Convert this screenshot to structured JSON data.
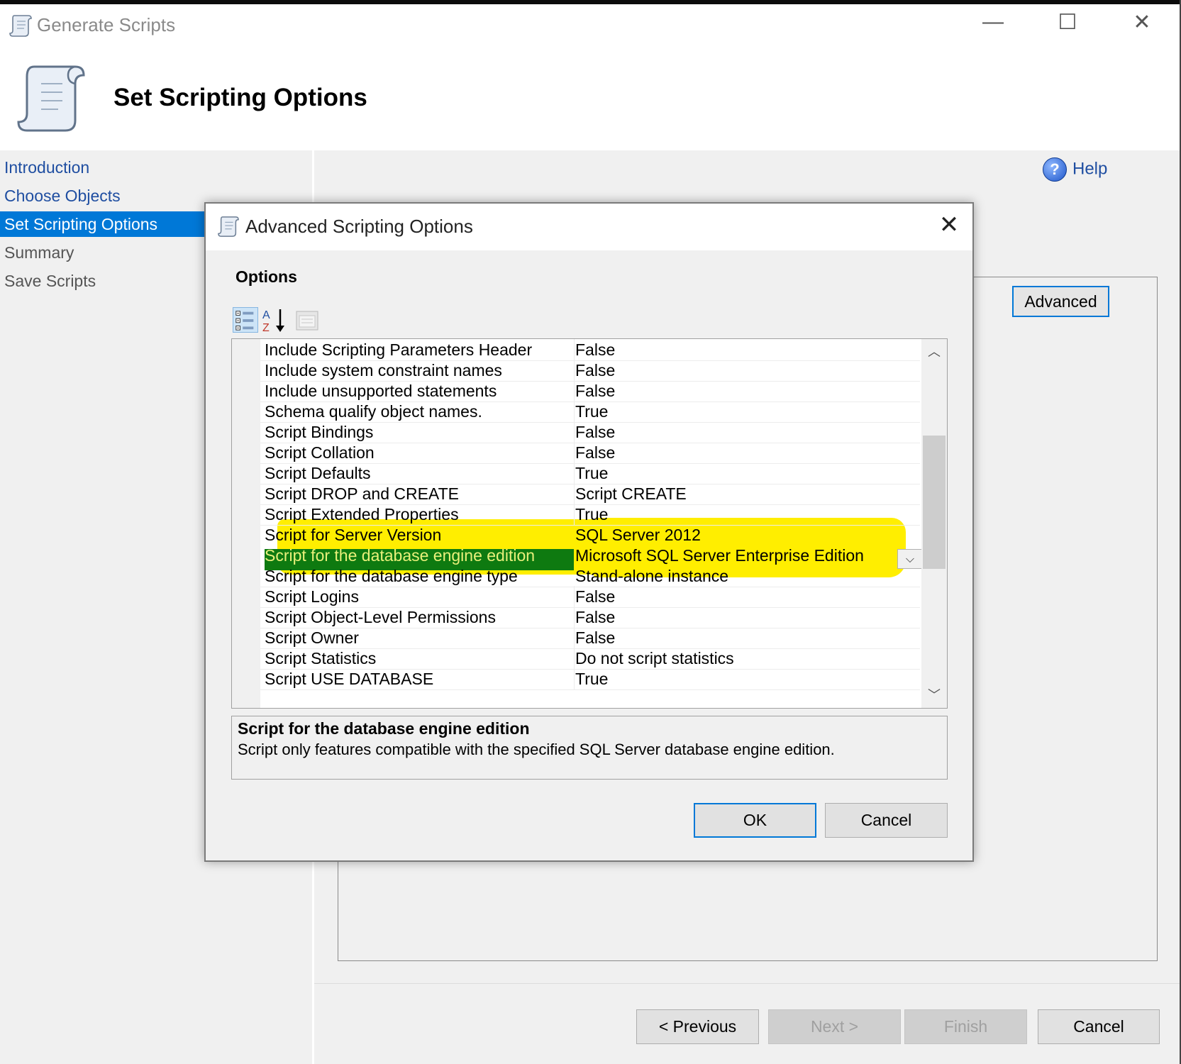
{
  "window": {
    "title": "Generate Scripts",
    "minimize_glyph": "—",
    "maximize_glyph": "☐",
    "close_glyph": "✕"
  },
  "header": {
    "title": "Set Scripting Options",
    "icon": "script-scroll-icon"
  },
  "sidebar": {
    "items": [
      {
        "label": "Introduction",
        "state": "link"
      },
      {
        "label": "Choose Objects",
        "state": "link"
      },
      {
        "label": "Set Scripting Options",
        "state": "selected"
      },
      {
        "label": "Summary",
        "state": "plain"
      },
      {
        "label": "Save Scripts",
        "state": "plain"
      }
    ]
  },
  "main": {
    "help_label": "Help",
    "advanced_label": "Advanced"
  },
  "footer": {
    "previous_label": "< Previous",
    "next_label": "Next >",
    "finish_label": "Finish",
    "cancel_label": "Cancel"
  },
  "dialog": {
    "title": "Advanced Scripting Options",
    "close_glyph": "✕",
    "options_label": "Options",
    "toolbar": [
      "categorized-icon",
      "alphabetical-sort-icon",
      "property-pages-icon"
    ],
    "rows": [
      {
        "name": "Include Scripting Parameters Header",
        "value": "False"
      },
      {
        "name": "Include system constraint names",
        "value": "False"
      },
      {
        "name": "Include unsupported statements",
        "value": "False"
      },
      {
        "name": "Schema qualify object names.",
        "value": "True"
      },
      {
        "name": "Script Bindings",
        "value": "False"
      },
      {
        "name": "Script Collation",
        "value": "False"
      },
      {
        "name": "Script Defaults",
        "value": "True"
      },
      {
        "name": "Script DROP and CREATE",
        "value": "Script CREATE"
      },
      {
        "name": "Script Extended Properties",
        "value": "True"
      },
      {
        "name": "Script for Server Version",
        "value": "SQL Server 2012"
      },
      {
        "name": "Script for the database engine edition",
        "value": "Microsoft SQL Server Enterprise Edition"
      },
      {
        "name": "Script for the database engine type",
        "value": "Stand-alone instance"
      },
      {
        "name": "Script Logins",
        "value": "False"
      },
      {
        "name": "Script Object-Level Permissions",
        "value": "False"
      },
      {
        "name": "Script Owner",
        "value": "False"
      },
      {
        "name": "Script Statistics",
        "value": "Do not script statistics"
      },
      {
        "name": "Script USE DATABASE",
        "value": "True"
      }
    ],
    "selected_row": "Script for the database engine edition",
    "scroll_up_glyph": "︿",
    "scroll_down_glyph": "﹀",
    "dropdown_glyph": "⌵",
    "description": {
      "title": "Script for the database engine edition",
      "text": "Script only features compatible with the specified SQL Server database engine edition."
    },
    "ok_label": "OK",
    "cancel_label": "Cancel"
  },
  "colors": {
    "accent": "#0078d7",
    "link": "#1f4ea1",
    "selection_green": "#0e7a10",
    "highlighter_yellow": "#ffee00"
  }
}
